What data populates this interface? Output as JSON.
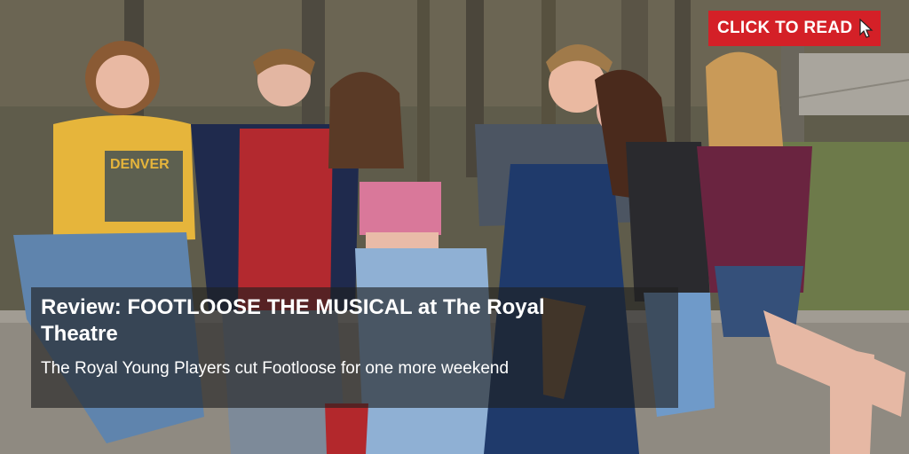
{
  "cta": {
    "label": "CLICK TO READ",
    "icon": "cursor-pointer-icon",
    "color": "#d42027"
  },
  "article": {
    "headline": "Review: FOOTLOOSE THE MUSICAL at The Royal Theatre",
    "subhead": "The Royal Young Players cut Footloose for one more weekend"
  },
  "image": {
    "shirt_text": "DENVER"
  }
}
